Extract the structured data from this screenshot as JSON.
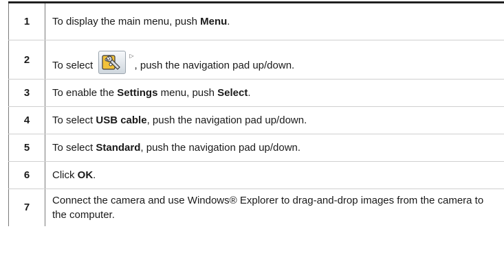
{
  "steps": [
    {
      "num": "1",
      "parts": {
        "a": "To display the main menu, push ",
        "b": "Menu",
        "c": "."
      }
    },
    {
      "num": "2",
      "parts": {
        "a": "To select ",
        "icon": "wrench-settings-icon",
        "arrow": "▷",
        "c": ", push the navigation pad up/down."
      }
    },
    {
      "num": "3",
      "parts": {
        "a": "To enable the ",
        "b": "Settings",
        "c": " menu, push ",
        "d": "Select",
        "e": "."
      }
    },
    {
      "num": "4",
      "parts": {
        "a": "To select ",
        "b": "USB cable",
        "c": ", push the navigation pad up/down."
      }
    },
    {
      "num": "5",
      "parts": {
        "a": "To select ",
        "b": "Standard",
        "c": ", push the navigation pad up/down."
      }
    },
    {
      "num": "6",
      "parts": {
        "a": "Click ",
        "b": "OK",
        "c": "."
      }
    },
    {
      "num": "7",
      "parts": {
        "a": "Connect the camera and use Windows® Explorer to drag-and-drop images from the camera to the computer."
      }
    }
  ],
  "colors": {
    "icon_body": "#f2c23a",
    "icon_outline": "#3a3a3a"
  }
}
